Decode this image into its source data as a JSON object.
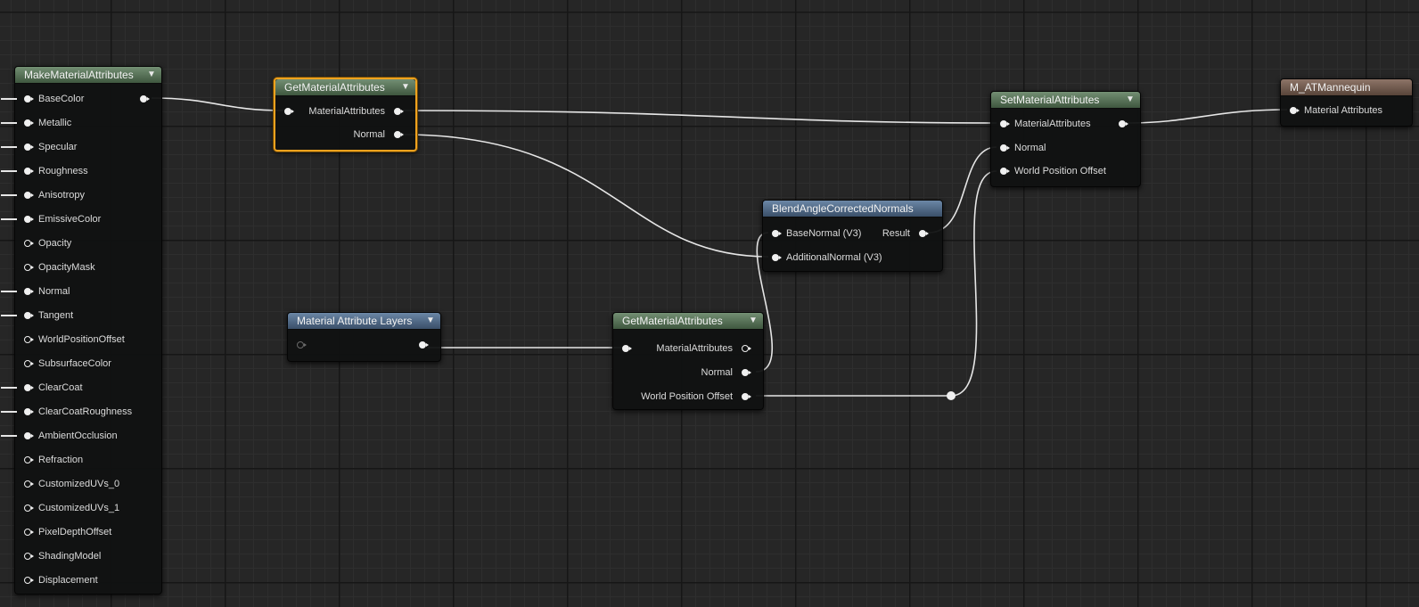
{
  "graph": {
    "make_node": {
      "title": "MakeMaterialAttributes",
      "inputs": [
        {
          "label": "BaseColor",
          "connected": true
        },
        {
          "label": "Metallic",
          "connected": true
        },
        {
          "label": "Specular",
          "connected": true
        },
        {
          "label": "Roughness",
          "connected": true
        },
        {
          "label": "Anisotropy",
          "connected": true
        },
        {
          "label": "EmissiveColor",
          "connected": true
        },
        {
          "label": "Opacity",
          "connected": false
        },
        {
          "label": "OpacityMask",
          "connected": false
        },
        {
          "label": "Normal",
          "connected": true
        },
        {
          "label": "Tangent",
          "connected": true
        },
        {
          "label": "WorldPositionOffset",
          "connected": false
        },
        {
          "label": "SubsurfaceColor",
          "connected": false
        },
        {
          "label": "ClearCoat",
          "connected": true
        },
        {
          "label": "ClearCoatRoughness",
          "connected": true
        },
        {
          "label": "AmbientOcclusion",
          "connected": true
        },
        {
          "label": "Refraction",
          "connected": false
        },
        {
          "label": "CustomizedUVs_0",
          "connected": false
        },
        {
          "label": "CustomizedUVs_1",
          "connected": false
        },
        {
          "label": "PixelDepthOffset",
          "connected": false
        },
        {
          "label": "ShadingModel",
          "connected": false
        },
        {
          "label": "Displacement",
          "connected": false
        }
      ]
    },
    "get_node_top": {
      "title": "GetMaterialAttributes",
      "input": "MaterialAttributes",
      "outputs": [
        "MaterialAttributes",
        "Normal"
      ]
    },
    "set_node": {
      "title": "SetMaterialAttributes",
      "inputs": [
        "MaterialAttributes",
        "Normal",
        "World Position Offset"
      ]
    },
    "result_node": {
      "title": "M_ATMannequin",
      "input": "Material Attributes"
    },
    "blend_node": {
      "title": "BlendAngleCorrectedNormals",
      "inputs": [
        "BaseNormal (V3)",
        "AdditionalNormal (V3)"
      ],
      "output": "Result"
    },
    "layers_node": {
      "title": "Material Attribute Layers"
    },
    "get_node_bottom": {
      "title": "GetMaterialAttributes",
      "input": "MaterialAttributes",
      "outputs": [
        "MaterialAttributes",
        "Normal",
        "World Position Offset"
      ]
    },
    "colors": {
      "header_green": "#738f73",
      "header_blue": "#6b87a6",
      "header_brown": "#8d7467",
      "selection": "#f0a21e",
      "wire": "#e6e6e6",
      "grid_background": "#262626"
    },
    "icons": {
      "collapse": "chevron-down-icon",
      "pin_connected": "pin-filled-icon",
      "pin_unconnected": "pin-hollow-icon"
    }
  }
}
